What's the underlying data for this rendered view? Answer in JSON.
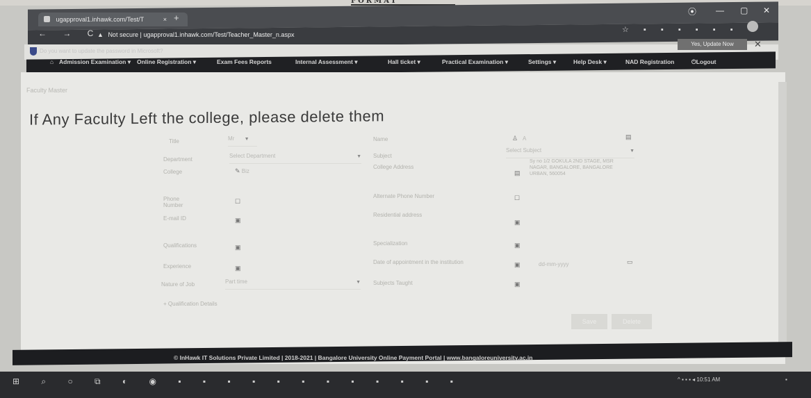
{
  "paper": {
    "fragment": "FORMAT"
  },
  "browser": {
    "tab_title": "ugapproval1.inhawk.com/Test/T",
    "tab_close": "×",
    "new_tab": "+",
    "url_warning": "Not secure",
    "url": "ugapproval1.inhawk.com/Test/Teacher_Master_n.aspx",
    "window_controls": [
      "⦿",
      "—",
      "▢",
      "✕"
    ],
    "nav_icons": "← → C",
    "ext_icons": "☆ ▪ ▪ ▪ ▪ ▪ ▪",
    "infobar_message": "Do you want to update the password in Microsoft?",
    "update_button": "Yes, Update Now",
    "infobar_close": "✕"
  },
  "menu": {
    "items": [
      "⌂",
      "Admission Examination ▾",
      "Online Registration ▾",
      "Exam Fees Reports",
      "Internal Assessment ▾",
      "Hall ticket ▾",
      "Practical Examination ▾",
      "Settings ▾",
      "Help Desk ▾",
      "NAD Registration",
      "⏻Logout"
    ]
  },
  "page": {
    "breadcrumb": "Faculty Master",
    "heading": "If Any Faculty Left the college, please delete them"
  },
  "form": {
    "title_label": "Title",
    "title_value": "Mr",
    "name_label": "Name",
    "name_value": "A",
    "department_label": "Department",
    "department_value": "Select Department",
    "subject_label": "Subject",
    "subject_value": "Select Subject",
    "college_label": "College",
    "college_value": "Biz",
    "college_address_label": "College Address",
    "college_address_value": "Sy no 1/2 GOKULA 2ND STAGE, MSR NAGAR, BANGALORE, BANGALORE URBAN, 560054",
    "phone_label": "Phone Number",
    "alt_phone_label": "Alternate Phone Number",
    "email_label": "E-mail ID",
    "residential_label": "Residential address",
    "qualifications_label": "Qualifications",
    "specialization_label": "Specialization",
    "experience_label": "Experience",
    "appointment_label": "Date of appointment in the institution",
    "appointment_placeholder": "dd-mm-yyyy",
    "nature_label": "Nature of Job",
    "nature_value": "Part time",
    "subjects_taught_label": "Subjects Taught",
    "add_link": "+ Qualification Details",
    "save_button": "Save",
    "delete_button": "Delete"
  },
  "footer": {
    "text": "© InHawk IT Solutions Private Limited | 2018-2021 | Bangalore University Online Payment Portal | www.bangaloreuniversity.ac.in"
  },
  "taskbar": {
    "icons": "⊞ ⌕ ○ ⧉ ◐ ◉ ▪ ▪ ▪ ▪ ▪ ▪ ▪ ▪ ▪ ▪ ▪ ▪",
    "tray": "^ ▪ ▪ ▪ ◂ 10:51 AM",
    "notification": "▪"
  }
}
